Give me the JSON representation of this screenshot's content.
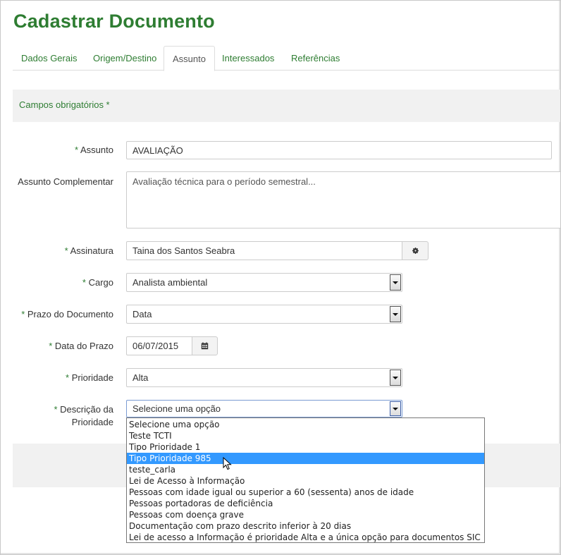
{
  "page": {
    "title": "Cadastrar Documento"
  },
  "tabs": [
    {
      "label": "Dados Gerais",
      "active": false
    },
    {
      "label": "Origem/Destino",
      "active": false
    },
    {
      "label": "Assunto",
      "active": true
    },
    {
      "label": "Interessados",
      "active": false
    },
    {
      "label": "Referências",
      "active": false
    }
  ],
  "form": {
    "required_note": "Campos obrigatórios *",
    "required_marker": "*",
    "assunto": {
      "label": "Assunto",
      "value": "AVALIAÇÃO"
    },
    "assunto_complementar": {
      "label": "Assunto Complementar",
      "value": "Avaliação técnica para o período semestral..."
    },
    "assinatura": {
      "label": "Assinatura",
      "value": "Taina dos Santos Seabra",
      "button_icon": "gear-icon"
    },
    "cargo": {
      "label": "Cargo",
      "value": "Analista ambiental"
    },
    "prazo_documento": {
      "label": "Prazo do Documento",
      "value": "Data"
    },
    "data_prazo": {
      "label": "Data do Prazo",
      "value": "06/07/2015",
      "button_icon": "calendar-icon"
    },
    "prioridade": {
      "label": "Prioridade",
      "value": "Alta"
    },
    "descricao_prioridade": {
      "label_line1": "Descrição da",
      "label_line2": "Prioridade",
      "value": "Selecione uma opção",
      "options": [
        "Selecione uma opção",
        "Teste TCTI",
        "Tipo Prioridade 1",
        "Tipo Prioridade 985",
        "teste_carla",
        "Lei de Acesso à Informação",
        "Pessoas com idade igual ou superior a 60 (sessenta) anos de idade",
        "Pessoas portadoras de deficiência",
        "Pessoas com doença grave",
        "Documentação com prazo descrito inferior à 20 dias",
        "Lei de acesso a Informação é prioridade Alta e a única opção para documentos SIC"
      ],
      "highlighted_index": 3
    }
  },
  "colors": {
    "accent_green": "#2e7d32",
    "highlight_blue": "#3399ff"
  }
}
